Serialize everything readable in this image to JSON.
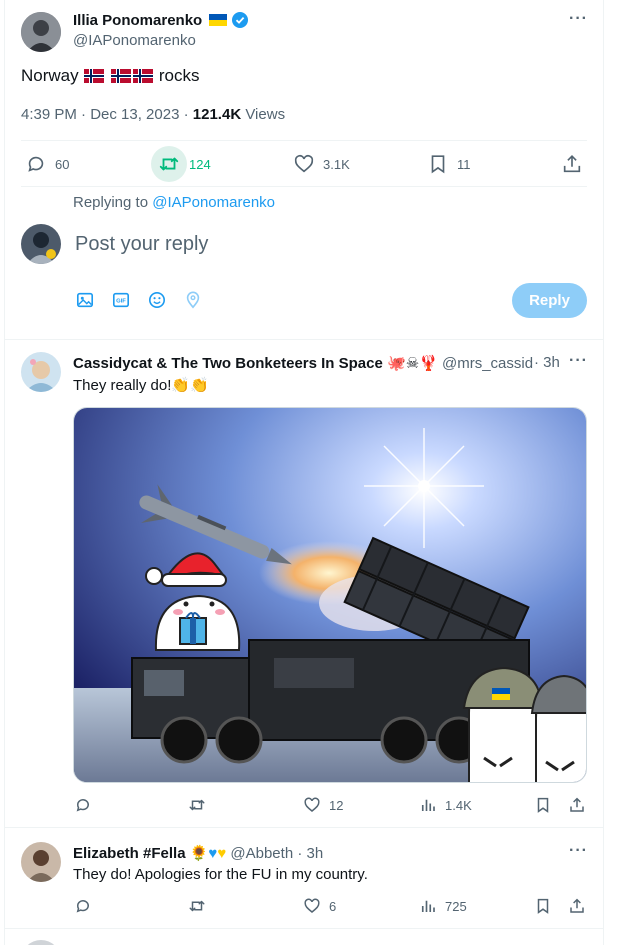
{
  "main_tweet": {
    "author_name": "Illia Ponomarenko",
    "handle": "@IAPonomarenko",
    "text_before": "Norway",
    "text_after": "rocks",
    "time": "4:39 PM · Dec 13, 2023",
    "separator": "·",
    "views_count": "121.4K",
    "views_label": "Views",
    "replies": "60",
    "retweets": "124",
    "likes": "3.1K",
    "bookmarks": "11"
  },
  "composer": {
    "replying_to_label": "Replying to",
    "replying_to_handle": "@IAPonomarenko",
    "placeholder": "Post your reply",
    "reply_button": "Reply"
  },
  "replies": [
    {
      "author_name": "Cassidycat & The Two Bonketeers In Space",
      "handle": "@mrs_cassidy",
      "time": "3h",
      "text": "They really do!",
      "likes": "12",
      "views": "1.4K"
    },
    {
      "author_name": "Elizabeth #Fella",
      "handle": "@Abbeth",
      "time": "3h",
      "text": "They do! Apologies for the FU in my country.",
      "likes": "6",
      "views": "725"
    }
  ],
  "colors": {
    "accent": "#1d9bf0",
    "retweet_green": "#00ba7c",
    "muted": "#536471",
    "reply_button_disabled": "#8ecdf8"
  }
}
